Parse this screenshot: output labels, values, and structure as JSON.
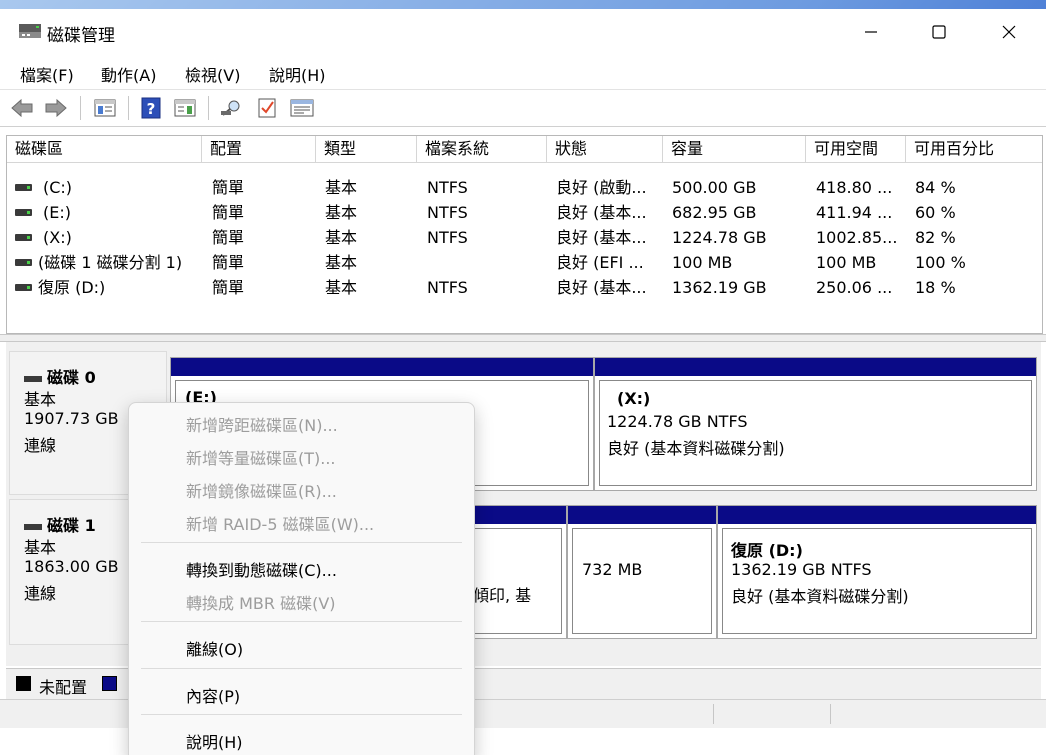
{
  "window": {
    "title": "磁碟管理",
    "min_glyph": "—",
    "max_glyph": "☐",
    "close_glyph": "✕"
  },
  "menu": [
    "檔案(F)",
    "動作(A)",
    "檢視(V)",
    "說明(H)"
  ],
  "toolbar": [
    "back-arrow-icon",
    "forward-arrow-icon",
    "console-tree-icon",
    "help-icon",
    "action-pane-icon",
    "rescan-icon",
    "checklist-icon",
    "properties-icon"
  ],
  "volume_list": {
    "columns": [
      "磁碟區",
      "配置",
      "類型",
      "檔案系統",
      "狀態",
      "容量",
      "可用空間",
      "可用百分比"
    ],
    "rows": [
      {
        "name": "(C:)",
        "layout": "簡單",
        "type": "基本",
        "fs": "NTFS",
        "status": "良好 (啟動...",
        "capacity": "500.00 GB",
        "free": "418.80 ...",
        "percent": "84 %"
      },
      {
        "name": "(E:)",
        "layout": "簡單",
        "type": "基本",
        "fs": "NTFS",
        "status": "良好 (基本...",
        "capacity": "682.95 GB",
        "free": "411.94 ...",
        "percent": "60 %"
      },
      {
        "name": "(X:)",
        "layout": "簡單",
        "type": "基本",
        "fs": "NTFS",
        "status": "良好 (基本...",
        "capacity": "1224.78 GB",
        "free": "1002.85...",
        "percent": "82 %"
      },
      {
        "name": "(磁碟 1 磁碟分割 1)",
        "layout": "簡單",
        "type": "基本",
        "fs": "",
        "status": "良好 (EFI ...",
        "capacity": "100 MB",
        "free": "100 MB",
        "percent": "100 %"
      },
      {
        "name": "復原 (D:)",
        "layout": "簡單",
        "type": "基本",
        "fs": "NTFS",
        "status": "良好 (基本...",
        "capacity": "1362.19 GB",
        "free": "250.06 ...",
        "percent": "18 %"
      }
    ]
  },
  "disks": [
    {
      "title": "磁碟 0",
      "type": "基本",
      "size": "1907.73 GB",
      "state": "連線",
      "partitions": [
        {
          "name": "(E:)",
          "line2": "",
          "line3": ""
        },
        {
          "name": "(X:)",
          "line2": "1224.78 GB NTFS",
          "line3": "良好 (基本資料磁碟分割)"
        }
      ]
    },
    {
      "title": "磁碟 1",
      "type": "基本",
      "size": "1863.00 GB",
      "state": "連線",
      "partitions": [
        {
          "name": "",
          "line2": "毀傾印, 基",
          "line3": ""
        },
        {
          "name": "",
          "line2": "732 MB",
          "line3": ""
        },
        {
          "name": "復原  (D:)",
          "line2": "1362.19 GB NTFS",
          "line3": "良好 (基本資料磁碟分割)"
        }
      ]
    }
  ],
  "legend": [
    {
      "label": "未配置",
      "color": "#000000"
    },
    {
      "label": "",
      "color": "#0a0a87"
    }
  ],
  "context_menu": {
    "items": [
      {
        "label": "新增跨距磁碟區(N)...",
        "enabled": false
      },
      {
        "label": "新增等量磁碟區(T)...",
        "enabled": false
      },
      {
        "label": "新增鏡像磁碟區(R)...",
        "enabled": false
      },
      {
        "label": "新增 RAID-5 磁碟區(W)...",
        "enabled": false
      },
      {
        "label": "轉換到動態磁碟(C)...",
        "enabled": true
      },
      {
        "label": "轉換成 MBR 磁碟(V)",
        "enabled": false
      },
      {
        "label": "離線(O)",
        "enabled": true
      },
      {
        "label": "內容(P)",
        "enabled": true
      },
      {
        "label": "說明(H)",
        "enabled": true
      }
    ]
  },
  "colors": {
    "partition_bar": "#0a0a87",
    "disabled_text": "#9d9d9d",
    "healthy_led": "#4ad04a"
  }
}
